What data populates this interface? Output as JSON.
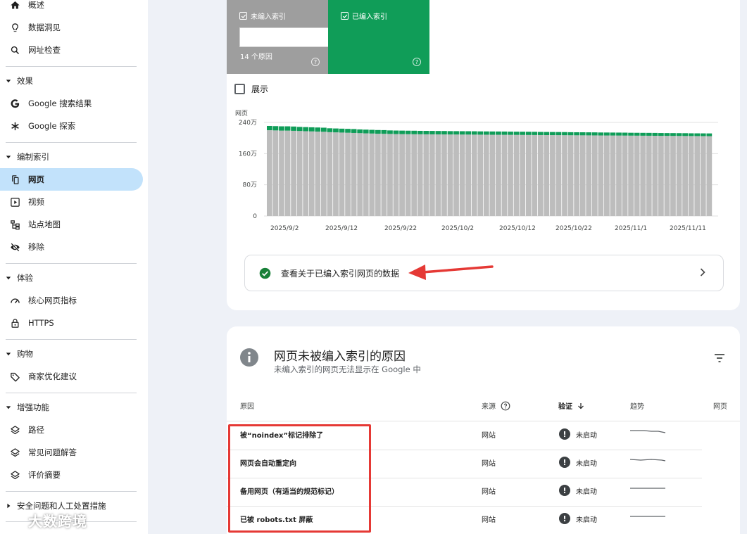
{
  "sidebar": {
    "top_items": [
      {
        "label": "概述",
        "icon": "home-icon"
      },
      {
        "label": "数据洞见",
        "icon": "lightbulb-icon"
      },
      {
        "label": "网址检查",
        "icon": "search-icon"
      }
    ],
    "sections": [
      {
        "label": "效果",
        "items": [
          {
            "label": "Google 搜索结果",
            "icon": "google-g-icon"
          },
          {
            "label": "Google 探索",
            "icon": "asterisk-icon"
          }
        ]
      },
      {
        "label": "编制索引",
        "items": [
          {
            "label": "网页",
            "icon": "pages-icon",
            "active": true
          },
          {
            "label": "视频",
            "icon": "video-icon"
          },
          {
            "label": "站点地图",
            "icon": "sitemap-icon"
          },
          {
            "label": "移除",
            "icon": "eye-off-icon"
          }
        ]
      },
      {
        "label": "体验",
        "items": [
          {
            "label": "核心网页指标",
            "icon": "gauge-icon"
          },
          {
            "label": "HTTPS",
            "icon": "lock-icon"
          }
        ]
      },
      {
        "label": "购物",
        "items": [
          {
            "label": "商家优化建议",
            "icon": "tag-icon"
          }
        ]
      },
      {
        "label": "增强功能",
        "items": [
          {
            "label": "路径",
            "icon": "layers-icon"
          },
          {
            "label": "常见问题解答",
            "icon": "layers-icon"
          },
          {
            "label": "评价摘要",
            "icon": "layers-icon"
          }
        ]
      },
      {
        "label": "安全问题和人工处置措施",
        "collapsed": true,
        "items": []
      }
    ],
    "watermark": "大数跨境"
  },
  "summary": {
    "not_indexed_label": "未编入索引",
    "not_indexed_reasons": "14 个原因",
    "indexed_label": "已编入索引",
    "help": "?"
  },
  "show_label": "展示",
  "chart_data": {
    "type": "bar",
    "stacked": true,
    "ylabel": "网页",
    "y_ticks": [
      "240万",
      "160万",
      "80万",
      "0"
    ],
    "ylim": [
      0,
      2400000
    ],
    "x_tick_labels": [
      "2025/9/2",
      "2025/9/12",
      "2025/9/22",
      "2025/10/2",
      "2025/10/12",
      "2025/10/22",
      "2025/11/1",
      "2025/11/11"
    ],
    "series": [
      {
        "name": "未编入索引",
        "color": "#bdbdbd",
        "values": [
          2200000,
          2195000,
          2190000,
          2190000,
          2185000,
          2180000,
          2175000,
          2170000,
          2165000,
          2160000,
          2150000,
          2145000,
          2140000,
          2135000,
          2130000,
          2125000,
          2120000,
          2115000,
          2110000,
          2108000,
          2105000,
          2102000,
          2100000,
          2098000,
          2097000,
          2096000,
          2095000,
          2094000,
          2093000,
          2092000,
          2091000,
          2090000,
          2089000,
          2088000,
          2087000,
          2086000,
          2085000,
          2084000,
          2083000,
          2082000,
          2081000,
          2080000,
          2079000,
          2078000,
          2077000,
          2076000,
          2075000,
          2074000,
          2073000,
          2072000,
          2071000,
          2070000,
          2069000,
          2068000,
          2067000,
          2066000,
          2065000,
          2064000,
          2063000,
          2062000,
          2061000,
          2060000,
          2059000,
          2058000,
          2057000,
          2056000,
          2055000,
          2054000,
          2053000,
          2052000,
          2051000,
          2050000,
          2049000,
          2048000
        ]
      },
      {
        "name": "已编入索引",
        "color": "#0f9d58",
        "values": [
          110000,
          110000,
          110000,
          110000,
          110000,
          105000,
          105000,
          105000,
          105000,
          105000,
          100000,
          100000,
          100000,
          100000,
          100000,
          95000,
          95000,
          95000,
          95000,
          95000,
          90000,
          90000,
          90000,
          90000,
          90000,
          88000,
          88000,
          88000,
          88000,
          88000,
          86000,
          86000,
          86000,
          86000,
          86000,
          84000,
          84000,
          84000,
          84000,
          84000,
          82000,
          82000,
          82000,
          82000,
          82000,
          80000,
          80000,
          80000,
          80000,
          80000,
          78000,
          78000,
          78000,
          78000,
          78000,
          76000,
          76000,
          76000,
          76000,
          76000,
          74000,
          74000,
          74000,
          74000,
          74000,
          72000,
          72000,
          72000,
          72000,
          72000,
          70000,
          70000,
          70000,
          70000
        ]
      }
    ]
  },
  "info_link": "查看关于已编入索引网页的数据",
  "reasons_card": {
    "title": "网页未被编入索引的原因",
    "subtitle": "未编入索引的网页无法显示在 Google 中",
    "columns": {
      "reason": "原因",
      "source": "来源",
      "validation": "验证",
      "trend": "趋势",
      "pages": "网页"
    },
    "rows": [
      {
        "reason": "被“noindex”标记排除了",
        "source": "网站",
        "status": "未启动"
      },
      {
        "reason": "网页会自动重定向",
        "source": "网站",
        "status": "未启动"
      },
      {
        "reason": "备用网页（有适当的规范标记）",
        "source": "网站",
        "status": "未启动"
      },
      {
        "reason": "已被 robots.txt 屏蔽",
        "source": "网站",
        "status": "未启动"
      }
    ]
  },
  "colors": {
    "accent": "#c2e2fb",
    "indexed": "#109d58",
    "not_indexed": "#9e9e9e",
    "annotation": "#e53935"
  }
}
